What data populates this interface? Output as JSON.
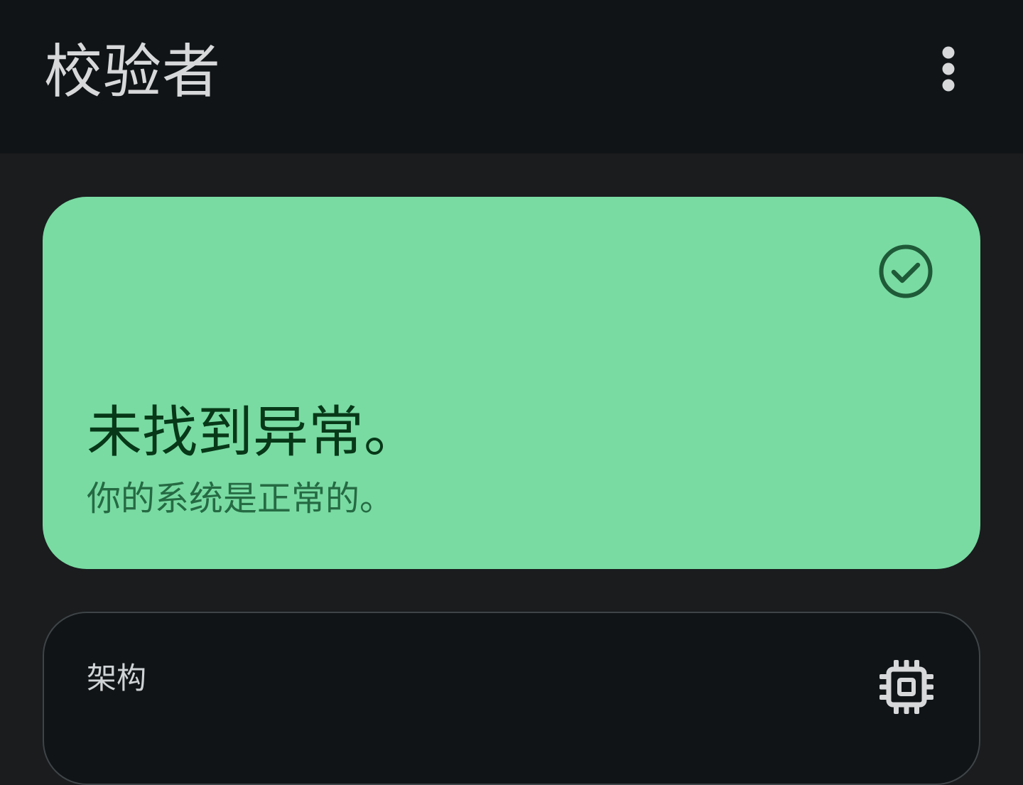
{
  "app": {
    "title": "校验者",
    "overflow_icon": "more-vert-icon"
  },
  "status_card": {
    "icon": "check-circle-icon",
    "title": "未找到异常。",
    "subtitle": "你的系统是正常的。",
    "background_color": "#79dba2",
    "title_color": "#073818",
    "subtitle_color": "#256a43"
  },
  "info_card": {
    "label": "架构",
    "icon": "cpu-chip-icon"
  },
  "colors": {
    "appbar": "#111416",
    "background": "#1a1c1e"
  }
}
